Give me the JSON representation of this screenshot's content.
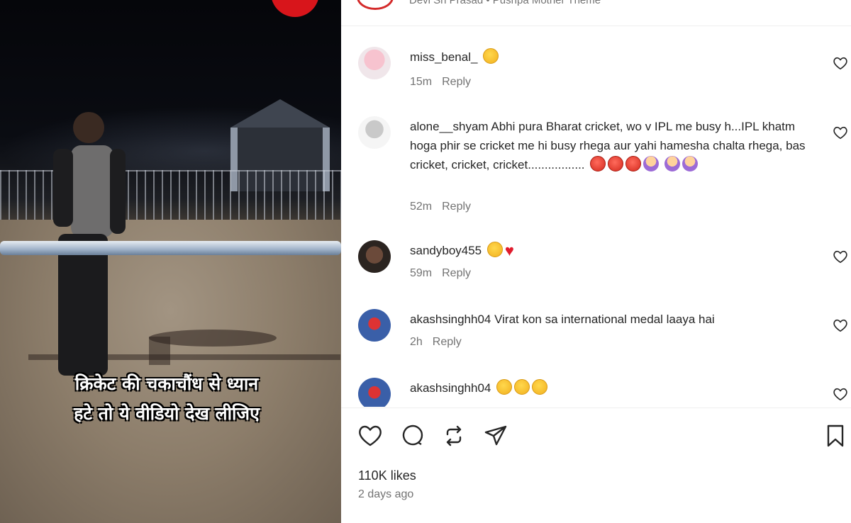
{
  "post": {
    "author_line": "Devi Sri Prasad • Pushpa Mother Theme",
    "caption_line1": "क्रिकेट की चकाचौंध से ध्यान",
    "caption_line2": "हटे तो ये वीडियो देख लीजिए"
  },
  "comments": [
    {
      "user": "miss_benal_",
      "text": "",
      "emojis": [
        "sad"
      ],
      "time": "15m",
      "reply": "Reply"
    },
    {
      "user": "alone__shyam",
      "text": "Abhi pura Bharat cricket, wo v IPL me busy h...IPL khatm hoga phir se cricket me hi busy rhega aur yahi hamesha chalta rhega, bas cricket, cricket, cricket.................",
      "emojis": [
        "angry",
        "angry",
        "angry",
        "facepalm",
        "facepalm",
        "facepalm"
      ],
      "time": "52m",
      "reply": "Reply"
    },
    {
      "user": "sandyboy455",
      "text": "",
      "emojis": [
        "sad",
        "heart"
      ],
      "time": "59m",
      "reply": "Reply"
    },
    {
      "user": "akashsinghh04",
      "text": "Virat kon sa international medal laaya hai",
      "emojis": [],
      "time": "2h",
      "reply": "Reply"
    },
    {
      "user": "akashsinghh04",
      "text": "",
      "emojis": [
        "sad",
        "sad",
        "sad"
      ],
      "time": "",
      "reply": ""
    }
  ],
  "actions": {
    "like_icon": "heart-icon",
    "comment_icon": "comment-icon",
    "share_icon": "repost-icon",
    "send_icon": "send-icon",
    "save_icon": "bookmark-icon"
  },
  "likes": "110K likes",
  "date": "2 days ago",
  "colors": {
    "accent_red": "#d8151b",
    "text": "#262626",
    "muted": "#737373"
  }
}
